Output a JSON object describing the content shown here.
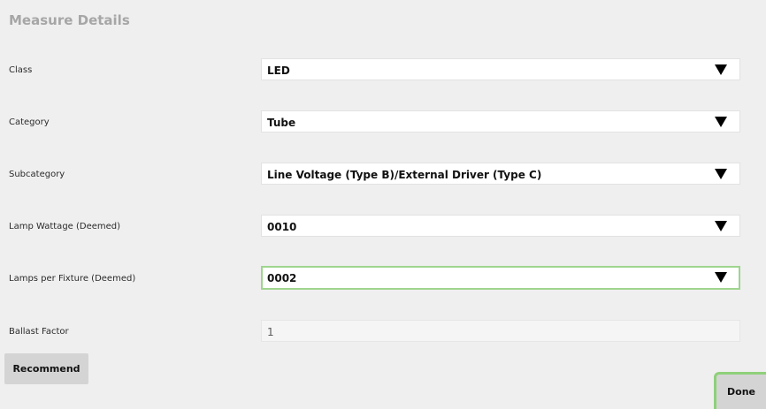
{
  "panel": {
    "title": "Measure Details"
  },
  "fields": [
    {
      "label": "Class",
      "value": "LED",
      "control": "dropdown",
      "arrow_icon": "triangle-down-icon"
    },
    {
      "label": "Category",
      "value": "Tube",
      "control": "dropdown",
      "arrow_icon": "triangle-down-icon"
    },
    {
      "label": "Subcategory",
      "value": "Line Voltage (Type B)/External Driver (Type C)",
      "control": "dropdown",
      "arrow_icon": "triangle-down-icon"
    },
    {
      "label": "Lamp Wattage (Deemed)",
      "value": "0010",
      "control": "dropdown",
      "arrow_icon": "triangle-down-icon"
    },
    {
      "label": "Lamps per Fixture (Deemed)",
      "value": "0002",
      "control": "dropdown",
      "focused": true,
      "arrow_icon": "triangle-down-icon"
    },
    {
      "label": "Ballast Factor",
      "value": "1",
      "control": "readonly"
    }
  ],
  "buttons": {
    "recommend_label": "Recommend",
    "done_label": "Done"
  },
  "colors": {
    "panel_background": "#efefef",
    "focus_border": "#9ed58e",
    "button_background": "#d4d4d4",
    "title_color": "#a6a6a6"
  }
}
